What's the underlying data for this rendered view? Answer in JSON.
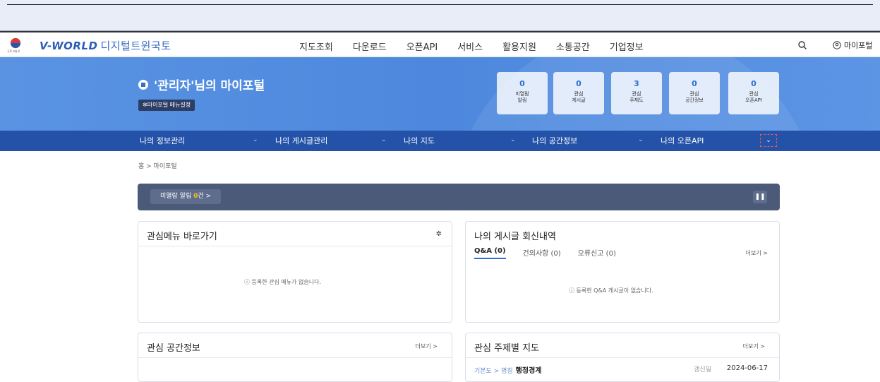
{
  "header": {
    "logo": "V-WORLD",
    "logo_sub": "디지털트윈국토",
    "emblem_caption": "국토교통부",
    "nav": [
      "지도조회",
      "다운로드",
      "오픈API",
      "서비스",
      "활용지원",
      "소통공간",
      "기업정보"
    ],
    "myportal": "마이포털"
  },
  "banner": {
    "title": "'관리자'님의 마이포털",
    "setting_button": "✲마이포털 메뉴설정",
    "stats": [
      {
        "num": "0",
        "label1": "미열람",
        "label2": "알림"
      },
      {
        "num": "0",
        "label1": "관심",
        "label2": "게시글"
      },
      {
        "num": "3",
        "label1": "관심",
        "label2": "주제도"
      },
      {
        "num": "0",
        "label1": "관심",
        "label2": "공간정보"
      },
      {
        "num": "0",
        "label1": "관심",
        "label2": "오픈API"
      }
    ]
  },
  "subnav": [
    "나의 정보관리",
    "나의 게시글관리",
    "나의 지도",
    "나의 공간정보",
    "나의 오픈API"
  ],
  "breadcrumb": "홈 > 마이포털",
  "alert": {
    "prefix": "미열람 알림 ",
    "count": "0",
    "suffix": "건 >"
  },
  "cards": {
    "fav_menu": {
      "title": "관심메뉴 바로가기",
      "empty": "ⓘ 등록한 관심 메뉴가 없습니다."
    },
    "my_posts": {
      "title": "나의 게시글 회신내역",
      "tabs": [
        "Q&A (0)",
        "건의사항 (0)",
        "오류신고 (0)"
      ],
      "more": "더보기 >",
      "empty": "ⓘ 등록한 Q&A 게시글이 없습니다."
    },
    "fav_space": {
      "title": "관심 공간정보",
      "more": "더보기 >"
    },
    "fav_maps": {
      "title": "관심 주제별 지도",
      "more": "더보기 >",
      "row": {
        "path": "기본도 > 명칭",
        "name": "행정경계",
        "date_label": "갱신일",
        "date": "2024-06-17"
      }
    }
  },
  "colors": {
    "brand": "#2352a8",
    "banner": "#4d88de",
    "alert_bar": "#4b5a78",
    "accent": "#2d6fd2"
  }
}
